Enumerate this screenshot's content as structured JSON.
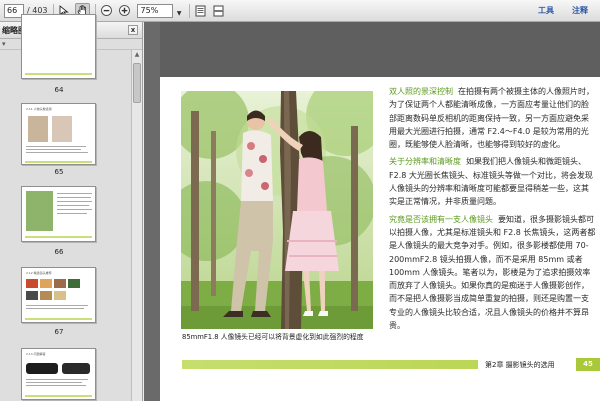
{
  "toolbar": {
    "page_current": "66",
    "page_total": "/ 403",
    "zoom": "75%",
    "tools_label": "工具",
    "comment_label": "注释"
  },
  "sidebar": {
    "title": "缩略图",
    "close": "x",
    "thumbnails": [
      {
        "page": "64"
      },
      {
        "page": "65",
        "title": "2.11 人物头像选用"
      },
      {
        "page": "66"
      },
      {
        "page": "67",
        "title": "2.12 精选镜头推荐"
      },
      {
        "page": "68",
        "title": "2.13 问题解答"
      }
    ]
  },
  "document": {
    "paragraphs": [
      {
        "highlight": "双人照的景深控制",
        "text": "在拍摄有两个被摄主体的人像照片时，为了保证两个人都能清晰成像，一方面应考量让他们的脸部距离数码单反相机的距离保持一致，另一方面应避免采用最大光圈进行拍摄，通常 F2.4～F4.0 是较为常用的光圈，既能够使人脸清晰，也能够得到较好的虚化。"
      },
      {
        "highlight": "关于分辨率和清晰度",
        "text": "如果我们把人像镜头和微距镜头、F2.8 大光圈长焦镜头、标准镜头等做一个对比，将会发现人像镜头的分辨率和清晰度可能都要显得稍差一些，这其实是正常情况，并非质量问题。"
      },
      {
        "highlight": "究竟是否该拥有一支人像镜头",
        "text": "要知道，很多摄影镜头都可以拍摄人像，尤其是标准镜头和 F2.8 长焦镜头，这两者都是人像镜头的最大竞争对手。例如，很多影楼都使用 70-200mmF2.8 镜头拍摄人像，而不是采用 85mm 或者 100mm 人像镜头。笔者以为，影楼是为了追求拍摄效率而放弃了人像镜头。如果你真的是痴迷于人像摄影创作，而不是把人像摄影当成简单重复的拍摄，则还是购置一支专业的人像镜头比较合适，况且人像镜头的价格并不算昂贵。"
      }
    ],
    "caption": "85mmF1.8 人像镜头已经可以将背景虚化到如此强烈的程度",
    "footer_chapter": "第2章  摄影镜头的选用",
    "footer_page": "45"
  }
}
